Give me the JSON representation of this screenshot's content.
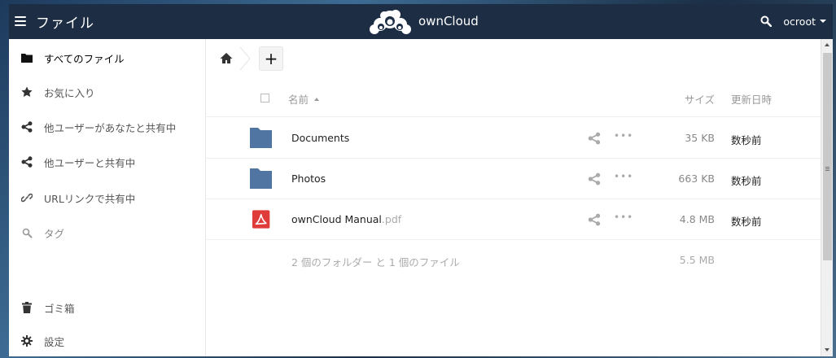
{
  "header": {
    "app_title": "ファイル",
    "logo_text": "ownCloud",
    "user_name": "ocroot"
  },
  "sidebar": {
    "items": [
      {
        "label": "すべてのファイル",
        "icon": "folder-icon"
      },
      {
        "label": "お気に入り",
        "icon": "star-icon"
      },
      {
        "label": "他ユーザーがあなたと共有中",
        "icon": "share-icon"
      },
      {
        "label": "他ユーザーと共有中",
        "icon": "share-icon"
      },
      {
        "label": "URLリンクで共有中",
        "icon": "link-icon"
      },
      {
        "label": "タグ",
        "icon": "tag-search-icon"
      },
      {
        "label": "ゴミ箱",
        "icon": "trash-icon"
      },
      {
        "label": "設定",
        "icon": "gear-icon"
      }
    ]
  },
  "table": {
    "columns": {
      "name": "名前",
      "size": "サイズ",
      "modified": "更新日時"
    },
    "rows": [
      {
        "name": "Documents",
        "ext": "",
        "type": "folder",
        "size": "35 KB",
        "modified": "数秒前"
      },
      {
        "name": "Photos",
        "ext": "",
        "type": "folder",
        "size": "663 KB",
        "modified": "数秒前"
      },
      {
        "name": "ownCloud Manual",
        "ext": ".pdf",
        "type": "pdf",
        "size": "4.8 MB",
        "modified": "数秒前"
      }
    ],
    "summary": {
      "text": "2 個のフォルダー と 1 個のファイル",
      "size": "5.5 MB"
    }
  },
  "toolbar": {
    "add_label": "+"
  },
  "colors": {
    "header_bg": "#1d2d44",
    "folder": "#5175a3",
    "pdf": "#e03b3b"
  }
}
